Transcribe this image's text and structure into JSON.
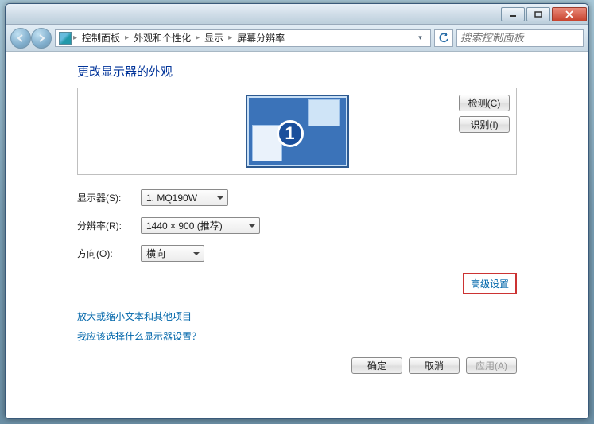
{
  "titlebar": {},
  "nav": {
    "crumbs": [
      "控制面板",
      "外观和个性化",
      "显示",
      "屏幕分辨率"
    ],
    "search_placeholder": "搜索控制面板"
  },
  "heading": "更改显示器的外观",
  "monitor": {
    "number": "1",
    "detect_label": "检测(C)",
    "identify_label": "识别(I)"
  },
  "form": {
    "display_label": "显示器(S):",
    "display_value": "1. MQ190W",
    "resolution_label": "分辨率(R):",
    "resolution_value": "1440 × 900 (推荐)",
    "orientation_label": "方向(O):",
    "orientation_value": "横向"
  },
  "advanced_link": "高级设置",
  "links": {
    "textsize": "放大或缩小文本和其他项目",
    "which_display": "我应该选择什么显示器设置？"
  },
  "footer": {
    "ok": "确定",
    "cancel": "取消",
    "apply": "应用(A)"
  }
}
